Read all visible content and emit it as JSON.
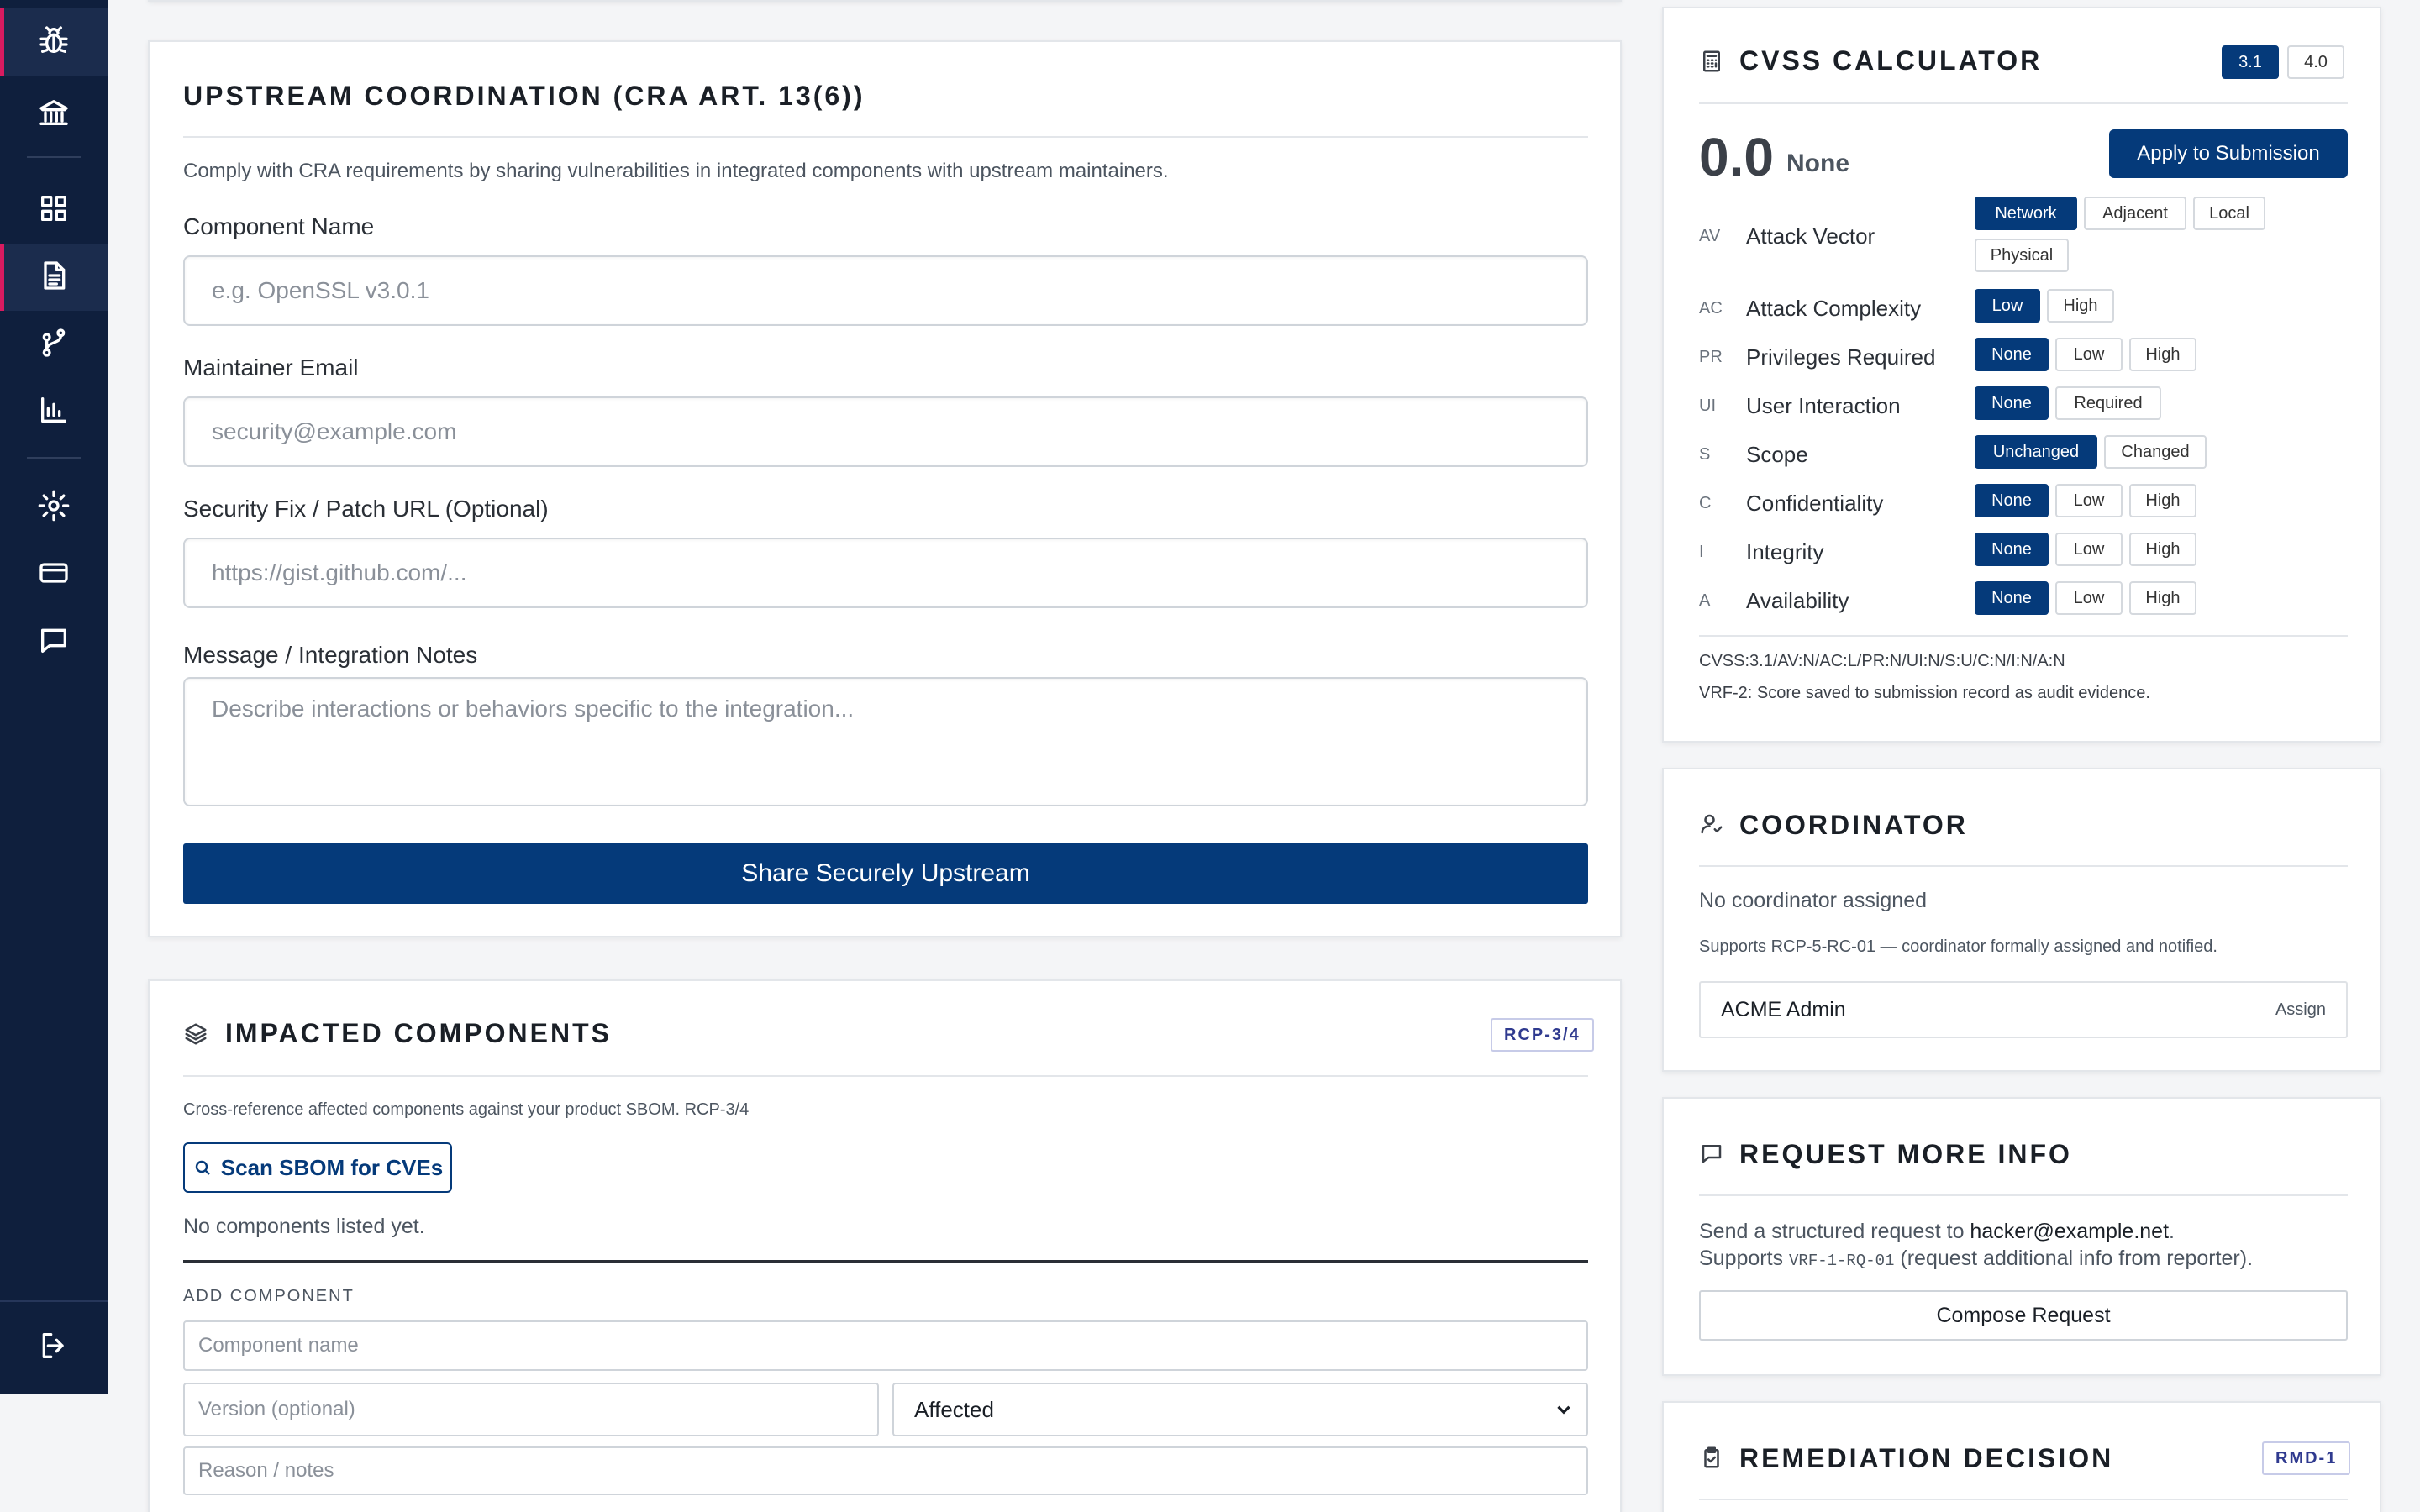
{
  "sidebar": {
    "icons": [
      "bug-icon",
      "bank-icon",
      "dashboard-icon",
      "document-icon",
      "git-branch-icon",
      "chart-icon",
      "settings-icon",
      "card-icon",
      "chat-icon",
      "logout-icon"
    ]
  },
  "upstream": {
    "title": "UPSTREAM COORDINATION (CRA ART. 13(6))",
    "description": "Comply with CRA requirements by sharing vulnerabilities in integrated components with upstream maintainers.",
    "component_label": "Component Name",
    "component_placeholder": "e.g. OpenSSL v3.0.1",
    "email_label": "Maintainer Email",
    "email_placeholder": "security@example.com",
    "patch_label": "Security Fix / Patch URL (Optional)",
    "patch_placeholder": "https://gist.github.com/...",
    "notes_label": "Message / Integration Notes",
    "notes_placeholder": "Describe interactions or behaviors specific to the integration...",
    "submit_label": "Share Securely Upstream"
  },
  "impacted": {
    "title": "IMPACTED COMPONENTS",
    "badge": "RCP-3/4",
    "description": "Cross-reference affected components against your product SBOM. RCP-3/4",
    "scan_label": "Scan SBOM for CVEs",
    "empty_text": "No components listed yet.",
    "add_heading": "ADD COMPONENT",
    "name_placeholder": "Component name",
    "version_placeholder": "Version (optional)",
    "status_value": "Affected",
    "reason_placeholder": "Reason / notes"
  },
  "cvss": {
    "title": "CVSS CALCULATOR",
    "versions": [
      "3.1",
      "4.0"
    ],
    "active_version": "3.1",
    "score": "0.0",
    "severity": "None",
    "apply_label": "Apply to Submission",
    "metrics": [
      {
        "abbr": "AV",
        "name": "Attack Vector",
        "options": [
          "Network",
          "Adjacent",
          "Local",
          "Physical"
        ],
        "selected": "Network"
      },
      {
        "abbr": "AC",
        "name": "Attack Complexity",
        "options": [
          "Low",
          "High"
        ],
        "selected": "Low"
      },
      {
        "abbr": "PR",
        "name": "Privileges Required",
        "options": [
          "None",
          "Low",
          "High"
        ],
        "selected": "None"
      },
      {
        "abbr": "UI",
        "name": "User Interaction",
        "options": [
          "None",
          "Required"
        ],
        "selected": "None"
      },
      {
        "abbr": "S",
        "name": "Scope",
        "options": [
          "Unchanged",
          "Changed"
        ],
        "selected": "Unchanged"
      },
      {
        "abbr": "C",
        "name": "Confidentiality",
        "options": [
          "None",
          "Low",
          "High"
        ],
        "selected": "None"
      },
      {
        "abbr": "I",
        "name": "Integrity",
        "options": [
          "None",
          "Low",
          "High"
        ],
        "selected": "None"
      },
      {
        "abbr": "A",
        "name": "Availability",
        "options": [
          "None",
          "Low",
          "High"
        ],
        "selected": "None"
      }
    ],
    "vector": "CVSS:3.1/AV:N/AC:L/PR:N/UI:N/S:U/C:N/I:N/A:N",
    "note": "VRF-2: Score saved to submission record as audit evidence."
  },
  "coordinator": {
    "title": "COORDINATOR",
    "status": "No coordinator assigned",
    "supports": "Supports RCP-5-RC-01 — coordinator formally assigned and notified.",
    "assignee": "ACME Admin",
    "assign_label": "Assign"
  },
  "request_info": {
    "title": "REQUEST MORE INFO",
    "line1_prefix": "Send a structured request to",
    "email": "hacker@example.net",
    "line1_suffix": ".",
    "line2_prefix": "Supports",
    "code": "VRF-1-RQ-01",
    "line2_suffix": "(request additional info from reporter).",
    "button_label": "Compose Request"
  },
  "remediation": {
    "title": "REMEDIATION DECISION",
    "badge": "RMD-1"
  },
  "colors": {
    "primary": "#053a7a",
    "sidebar": "#0f1f3d",
    "accent": "#d81b60"
  }
}
